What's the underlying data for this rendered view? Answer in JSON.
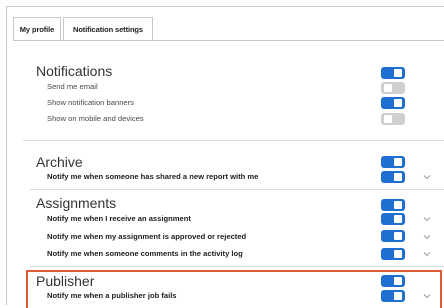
{
  "tabs": [
    {
      "label": "My profile"
    },
    {
      "label": "Notification settings"
    }
  ],
  "notifications": {
    "title": "Notifications",
    "rows": [
      {
        "label": "Send me email",
        "on": false
      },
      {
        "label": "Show notification banners",
        "on": true
      },
      {
        "label": "Show on mobile and devices",
        "on": false
      }
    ],
    "master_on": true
  },
  "archive": {
    "title": "Archive",
    "master_on": true,
    "rows": [
      {
        "label": "Notify me when someone has shared a new report with me",
        "on": true
      }
    ]
  },
  "assignments": {
    "title": "Assignments",
    "master_on": true,
    "rows": [
      {
        "label": "Notify me when I receive an assignment",
        "on": true
      },
      {
        "label": "Notify me when my assignment is approved or rejected",
        "on": true
      },
      {
        "label": "Notify me when someone comments in the activity log",
        "on": true
      }
    ]
  },
  "publisher": {
    "title": "Publisher",
    "master_on": true,
    "rows": [
      {
        "label": "Notify me when a publisher job fails",
        "on": true
      }
    ]
  },
  "colors": {
    "toggle_on": "#1f6fd1",
    "toggle_off": "#cfcfcf",
    "highlight": "#e05a3a"
  },
  "icons": {
    "expand": "chevron-down-icon"
  }
}
